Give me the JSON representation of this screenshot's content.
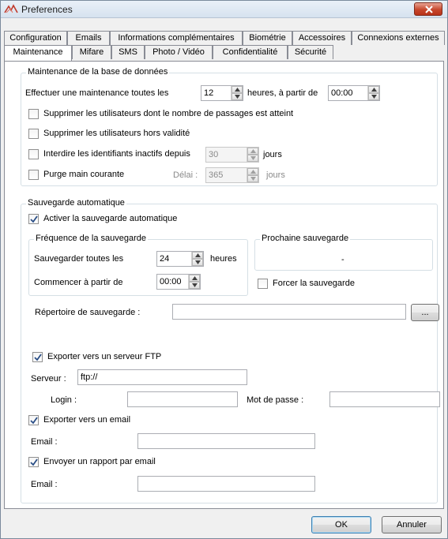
{
  "window": {
    "title": "Preferences"
  },
  "tabs": {
    "row1": [
      "Configuration",
      "Emails",
      "Informations complémentaires",
      "Biométrie",
      "Accessoires",
      "Connexions externes"
    ],
    "row2": [
      "Maintenance",
      "Mifare",
      "SMS",
      "Photo / Vidéo",
      "Confidentialité",
      "Sécurité"
    ],
    "active": "Maintenance"
  },
  "maintenance": {
    "group_title": "Maintenance de la base de données",
    "interval_label": "Effectuer une maintenance toutes les",
    "interval_value": "12",
    "hours_from_label": "heures,  à partir de",
    "start_time": "00:00",
    "delete_max_passages_label": "Supprimer les utilisateurs dont le nombre de passages est atteint",
    "delete_max_passages_checked": false,
    "delete_out_of_validity_label": "Supprimer les utilisateurs hors validité",
    "delete_out_of_validity_checked": false,
    "forbid_inactive_label": "Interdire les identifiants inactifs depuis",
    "forbid_inactive_checked": false,
    "forbid_inactive_days": "30",
    "days_label": "jours",
    "purge_label": "Purge main courante",
    "purge_checked": false,
    "delay_label": "Délai :",
    "purge_delay": "365",
    "purge_days_label": "jours"
  },
  "backup": {
    "group_title": "Sauvegarde automatique",
    "enable_label": "Activer la sauvegarde automatique",
    "enable_checked": true,
    "frequency_title": "Fréquence de la sauvegarde",
    "every_label": "Sauvegarder toutes les",
    "every_value": "24",
    "hours_label": "heures",
    "start_label": "Commencer à partir de",
    "start_value": "00:00",
    "next_title": "Prochaine sauvegarde",
    "next_value": "-",
    "force_label": "Forcer la sauvegarde",
    "force_checked": false,
    "directory_label": "Répertoire de sauvegarde :",
    "directory_value": "",
    "browse_label": "...",
    "ftp_label": "Exporter vers un serveur FTP",
    "ftp_checked": true,
    "server_label": "Serveur :",
    "server_value": "ftp://",
    "login_label": "Login :",
    "login_value": "",
    "password_label": "Mot de passe :",
    "password_value": "",
    "email_export_label": "Exporter vers un email",
    "email_export_checked": true,
    "email_label_1": "Email :",
    "email_value_1": "",
    "report_label": "Envoyer un rapport par email",
    "report_checked": true,
    "email_label_2": "Email :",
    "email_value_2": ""
  },
  "footer": {
    "ok_label": "OK",
    "cancel_label": "Annuler"
  }
}
